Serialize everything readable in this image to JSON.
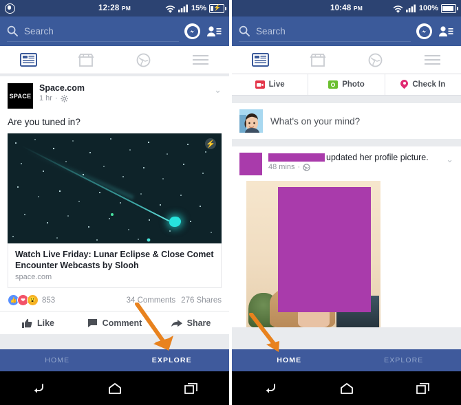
{
  "left_phone": {
    "status": {
      "time": "12:28",
      "ampm": "PM",
      "battery_text": "15%",
      "wifi_icon": "wifi-icon",
      "signal_icon": "signal-bars-icon",
      "battery_icon": "battery-charging-icon",
      "app_icon": "circle-app-icon"
    },
    "search": {
      "placeholder": "Search",
      "icon": "search-icon"
    },
    "header_actions": {
      "messenger": "messenger-icon",
      "friend_requests": "friend-requests-icon"
    },
    "tabs": [
      {
        "name": "news-feed",
        "icon": "news-feed-icon",
        "active": true
      },
      {
        "name": "marketplace",
        "icon": "marketplace-store-icon",
        "active": false
      },
      {
        "name": "notifications",
        "icon": "globe-icon",
        "active": false
      },
      {
        "name": "menu",
        "icon": "hamburger-menu-icon",
        "active": false
      }
    ],
    "post": {
      "logo_text": "SPACE",
      "author": "Space.com",
      "time": "1 hr",
      "privacy_icon": "gear-icon",
      "body": "Are you tuned in?",
      "photo_badge": "instant-article-bolt-icon",
      "link_title": "Watch Live Friday: Lunar Eclipse & Close Comet Encounter Webcasts by Slooh",
      "link_domain": "space.com",
      "reactions_count": "853",
      "comments": "34 Comments",
      "shares": "276 Shares",
      "actions": [
        {
          "label": "Like",
          "icon": "thumbs-up-icon"
        },
        {
          "label": "Comment",
          "icon": "comment-bubble-icon"
        },
        {
          "label": "Share",
          "icon": "share-arrow-icon"
        }
      ]
    },
    "bottom_nav": [
      {
        "label": "HOME",
        "active": false
      },
      {
        "label": "EXPLORE",
        "active": true
      }
    ],
    "android_nav": [
      {
        "name": "back-button",
        "icon": "back-arrow-icon"
      },
      {
        "name": "home-button",
        "icon": "home-icon"
      },
      {
        "name": "recents-button",
        "icon": "recent-apps-icon"
      }
    ]
  },
  "right_phone": {
    "status": {
      "time": "10:48",
      "ampm": "PM",
      "battery_text": "100%",
      "wifi_icon": "wifi-icon",
      "signal_icon": "signal-bars-icon",
      "battery_icon": "battery-full-icon"
    },
    "search": {
      "placeholder": "Search",
      "icon": "search-icon"
    },
    "header_actions": {
      "messenger": "messenger-icon",
      "friend_requests": "friend-requests-icon"
    },
    "tabs": [
      {
        "name": "news-feed",
        "icon": "news-feed-icon",
        "active": true
      },
      {
        "name": "marketplace",
        "icon": "marketplace-store-icon",
        "active": false
      },
      {
        "name": "notifications",
        "icon": "globe-icon",
        "active": false
      },
      {
        "name": "menu",
        "icon": "hamburger-menu-icon",
        "active": false
      }
    ],
    "composer_shortcuts": [
      {
        "label": "Live",
        "icon": "live-video-icon",
        "color": "#e4364a"
      },
      {
        "label": "Photo",
        "icon": "photo-camera-icon",
        "color": "#6bbf2f"
      },
      {
        "label": "Check In",
        "icon": "location-pin-icon",
        "color": "#e02b72"
      }
    ],
    "composer": {
      "avatar": "user-avatar",
      "placeholder": "What's on your mind?"
    },
    "post": {
      "author_redacted": "",
      "action_text": "updated her profile picture.",
      "time": "48 mins",
      "privacy_icon": "globe-icon",
      "chevron_icon": "chevron-down-icon"
    },
    "bottom_nav": [
      {
        "label": "HOME",
        "active": true
      },
      {
        "label": "EXPLORE",
        "active": false
      }
    ],
    "android_nav": [
      {
        "name": "back-button",
        "icon": "back-arrow-icon"
      },
      {
        "name": "home-button",
        "icon": "home-icon"
      },
      {
        "name": "recents-button",
        "icon": "recent-apps-icon"
      }
    ]
  },
  "annotations": {
    "arrow_color": "#e8821e",
    "left_arrow_target": "EXPLORE",
    "right_arrow_target": "HOME"
  },
  "colors": {
    "status_bar": "#2c4372",
    "fb_blue": "#3b5a9a",
    "bottom_nav": "#3f5a9c",
    "redaction": "#a93bab",
    "page_bg": "#e9ebee"
  }
}
